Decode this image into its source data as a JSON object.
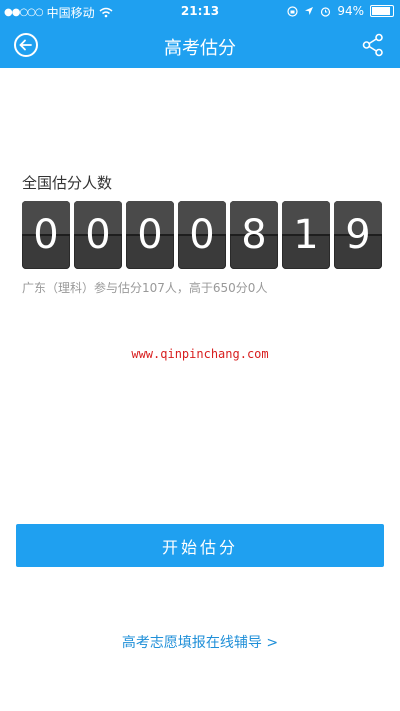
{
  "status_bar": {
    "signal": "●●○○○",
    "carrier": "中国移动",
    "time": "21:13",
    "battery": "94%"
  },
  "header": {
    "title": "高考估分"
  },
  "stats": {
    "label": "全国估分人数",
    "digits": [
      "0",
      "0",
      "0",
      "0",
      "8",
      "1",
      "9"
    ],
    "region_info": "广东（理科）参与估分107人，高于650分0人"
  },
  "watermark": "www.qinpinchang.com",
  "actions": {
    "start_label": "开始估分",
    "guide_link": "高考志愿填报在线辅导 >"
  },
  "colors": {
    "brand": "#1fa0f0",
    "link": "#1f8fd8",
    "counter_bg": "#3a3a3a"
  }
}
